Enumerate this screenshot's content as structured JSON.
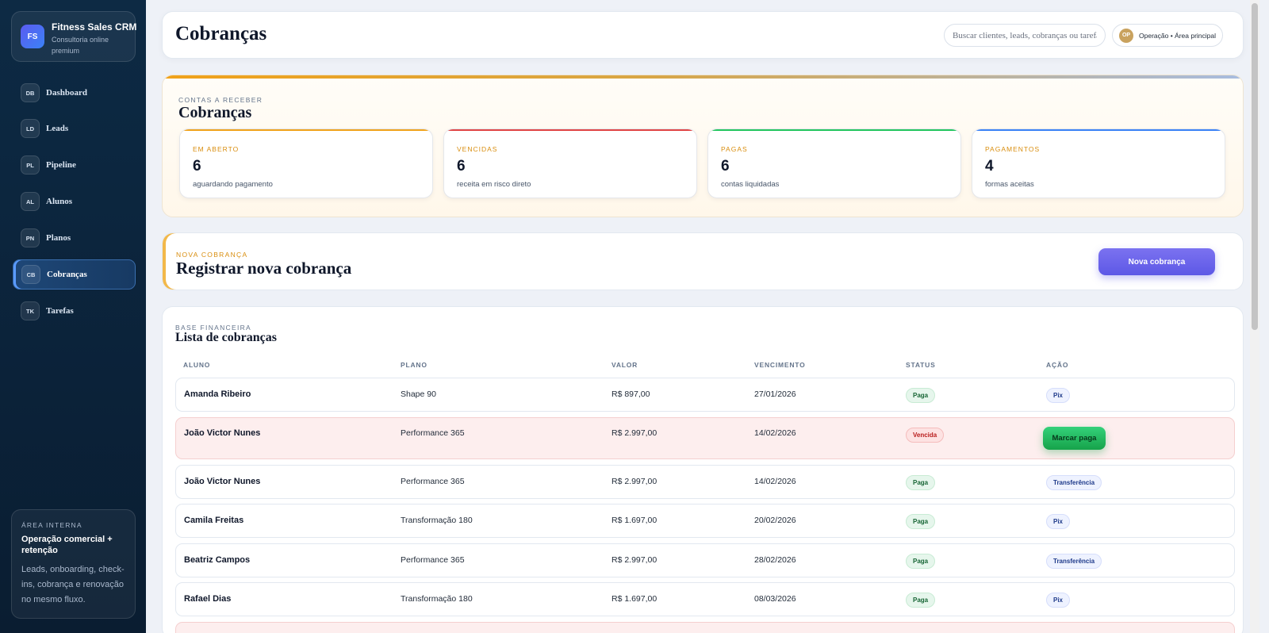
{
  "brand": {
    "logo": "FS",
    "name": "Fitness Sales CRM",
    "subtitle": "Consultoria online premium"
  },
  "sidebar": {
    "items": [
      {
        "badge": "DB",
        "label": "Dashboard",
        "active": false
      },
      {
        "badge": "LD",
        "label": "Leads",
        "active": false
      },
      {
        "badge": "PL",
        "label": "Pipeline",
        "active": false
      },
      {
        "badge": "AL",
        "label": "Alunos",
        "active": false
      },
      {
        "badge": "PN",
        "label": "Planos",
        "active": false
      },
      {
        "badge": "CB",
        "label": "Cobranças",
        "active": true
      },
      {
        "badge": "TK",
        "label": "Tarefas",
        "active": false
      }
    ],
    "internal": {
      "kicker": "ÁREA INTERNA",
      "title": "Operação comercial + retenção",
      "description": "Leads, onboarding, check-ins, cobrança e renovação no mesmo fluxo."
    }
  },
  "header": {
    "title": "Cobranças",
    "search_placeholder": "Buscar clientes, leads, cobranças ou tarefas",
    "user_initials": "OP",
    "user_label": "Operação • Área principal"
  },
  "overview": {
    "kicker": "CONTAS A RECEBER",
    "title": "Cobranças",
    "stats": [
      {
        "label": "EM ABERTO",
        "value": "6",
        "description": "aguardando pagamento",
        "color": "#f0a21a"
      },
      {
        "label": "VENCIDAS",
        "value": "6",
        "description": "receita em risco direto",
        "color": "#e04444"
      },
      {
        "label": "PAGAS",
        "value": "6",
        "description": "contas liquidadas",
        "color": "#22c55e"
      },
      {
        "label": "PAGAMENTOS",
        "value": "4",
        "description": "formas aceitas",
        "color": "#3b82f6"
      }
    ]
  },
  "new_charge": {
    "kicker": "NOVA COBRANÇA",
    "title": "Registrar nova cobrança",
    "button_label": "Nova cobrança"
  },
  "list": {
    "kicker": "BASE FINANCEIRA",
    "title": "Lista de cobranças",
    "columns": [
      "ALUNO",
      "PLANO",
      "VALOR",
      "VENCIMENTO",
      "STATUS",
      "AÇÃO"
    ],
    "rows": [
      {
        "aluno": "Amanda Ribeiro",
        "plano": "Shape 90",
        "valor": "R$ 897,00",
        "vencimento": "27/01/2026",
        "status": "Paga",
        "status_type": "paid",
        "acao": "Pix",
        "acao_type": "pill"
      },
      {
        "aluno": "João Victor Nunes",
        "plano": "Performance 365",
        "valor": "R$ 2.997,00",
        "vencimento": "14/02/2026",
        "status": "Vencida",
        "status_type": "late",
        "acao": "Marcar paga",
        "acao_type": "button"
      },
      {
        "aluno": "João Victor Nunes",
        "plano": "Performance 365",
        "valor": "R$ 2.997,00",
        "vencimento": "14/02/2026",
        "status": "Paga",
        "status_type": "paid",
        "acao": "Transferência",
        "acao_type": "pill"
      },
      {
        "aluno": "Camila Freitas",
        "plano": "Transformação 180",
        "valor": "R$ 1.697,00",
        "vencimento": "20/02/2026",
        "status": "Paga",
        "status_type": "paid",
        "acao": "Pix",
        "acao_type": "pill"
      },
      {
        "aluno": "Beatriz Campos",
        "plano": "Performance 365",
        "valor": "R$ 2.997,00",
        "vencimento": "28/02/2026",
        "status": "Paga",
        "status_type": "paid",
        "acao": "Transferência",
        "acao_type": "pill"
      },
      {
        "aluno": "Rafael Dias",
        "plano": "Transformação 180",
        "valor": "R$ 1.697,00",
        "vencimento": "08/03/2026",
        "status": "Paga",
        "status_type": "paid",
        "acao": "Pix",
        "acao_type": "pill"
      }
    ]
  }
}
